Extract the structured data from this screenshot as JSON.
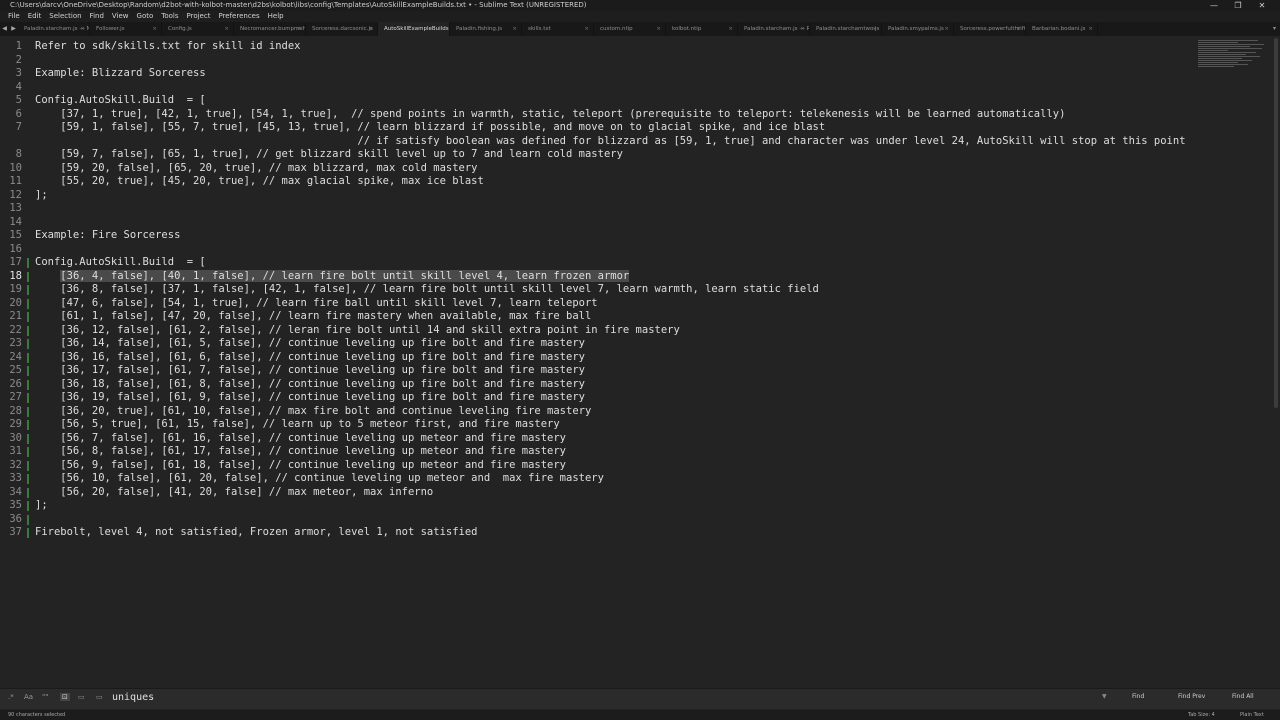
{
  "window": {
    "title": "C:\\Users\\darcv\\OneDrive\\Desktop\\Random\\d2bot-with-kolbot-master\\d2bs\\kolbot\\libs\\config\\Templates\\AutoSkillExampleBuilds.txt • - Sublime Text (UNREGISTERED)",
    "controls": [
      "—",
      "❐",
      "✕"
    ]
  },
  "menu": [
    "File",
    "Edit",
    "Selection",
    "Find",
    "View",
    "Goto",
    "Tools",
    "Project",
    "Preferences",
    "Help"
  ],
  "tabs": [
    "Paladin.starcham.js — New Kolbot\\...\\config",
    "Follower.js",
    "Config.js",
    "Necromancer.bumpmehard.js",
    "Sorceress.darcsonic.js",
    "AutoSkillExampleBuilds.txt",
    "Paladin.fishing.js",
    "skills.txt",
    "custom.ntip",
    "kolbot.ntip",
    "Paladin.starcham.js — Random\\...\\config",
    "Paladin.starchamtwo.js",
    "Paladin.smypalms.js",
    "Sorceress.powerfulthrift.js",
    "Barbarian.bodani.js"
  ],
  "active_tab": 5,
  "editor": {
    "selected_line": 18,
    "lines": [
      {
        "n": "1",
        "text": "Refer to sdk/skills.txt for skill id index"
      },
      {
        "n": "2",
        "text": ""
      },
      {
        "n": "3",
        "text": "Example: Blizzard Sorceress"
      },
      {
        "n": "4",
        "text": ""
      },
      {
        "n": "5",
        "text": "Config.AutoSkill.Build  = ["
      },
      {
        "n": "6",
        "text": "    [37, 1, true], [42, 1, true], [54, 1, true],  // spend points in warmth, static, teleport (prerequisite to teleport: telekenesis will be learned automatically)"
      },
      {
        "n": "7",
        "text": "    [59, 1, false], [55, 7, true], [45, 13, true], // learn blizzard if possible, and move on to glacial spike, and ice blast"
      },
      {
        "n": "",
        "text": "                                                   // if satisfy boolean was defined for blizzard as [59, 1, true] and character was under level 24, AutoSkill will stop at this point"
      },
      {
        "n": "8",
        "text": "    [59, 7, false], [65, 1, true], // get blizzard skill level up to 7 and learn cold mastery"
      },
      {
        "n": "10",
        "text": "    [59, 20, false], [65, 20, true], // max blizzard, max cold mastery"
      },
      {
        "n": "11",
        "text": "    [55, 20, true], [45, 20, true], // max glacial spike, max ice blast"
      },
      {
        "n": "12",
        "text": "];"
      },
      {
        "n": "13",
        "text": ""
      },
      {
        "n": "14",
        "text": ""
      },
      {
        "n": "15",
        "text": "Example: Fire Sorceress"
      },
      {
        "n": "16",
        "text": ""
      },
      {
        "n": "17",
        "text": "Config.AutoSkill.Build  = ["
      },
      {
        "n": "18",
        "text": "    [36, 4, false], [40, 1, false], // learn fire bolt until skill level 4, learn frozen armor"
      },
      {
        "n": "19",
        "text": "    [36, 8, false], [37, 1, false], [42, 1, false], // learn fire bolt until skill level 7, learn warmth, learn static field"
      },
      {
        "n": "20",
        "text": "    [47, 6, false], [54, 1, true], // learn fire ball until skill level 7, learn teleport"
      },
      {
        "n": "21",
        "text": "    [61, 1, false], [47, 20, false], // learn fire mastery when available, max fire ball"
      },
      {
        "n": "22",
        "text": "    [36, 12, false], [61, 2, false], // leran fire bolt until 14 and skill extra point in fire mastery"
      },
      {
        "n": "23",
        "text": "    [36, 14, false], [61, 5, false], // continue leveling up fire bolt and fire mastery"
      },
      {
        "n": "24",
        "text": "    [36, 16, false], [61, 6, false], // continue leveling up fire bolt and fire mastery"
      },
      {
        "n": "25",
        "text": "    [36, 17, false], [61, 7, false], // continue leveling up fire bolt and fire mastery"
      },
      {
        "n": "26",
        "text": "    [36, 18, false], [61, 8, false], // continue leveling up fire bolt and fire mastery"
      },
      {
        "n": "27",
        "text": "    [36, 19, false], [61, 9, false], // continue leveling up fire bolt and fire mastery"
      },
      {
        "n": "28",
        "text": "    [36, 20, true], [61, 10, false], // max fire bolt and continue leveling fire mastery"
      },
      {
        "n": "29",
        "text": "    [56, 5, true], [61, 15, false], // learn up to 5 meteor first, and fire mastery"
      },
      {
        "n": "30",
        "text": "    [56, 7, false], [61, 16, false], // continue leveling up meteor and fire mastery"
      },
      {
        "n": "31",
        "text": "    [56, 8, false], [61, 17, false], // continue leveling up meteor and fire mastery"
      },
      {
        "n": "32",
        "text": "    [56, 9, false], [61, 18, false], // continue leveling up meteor and fire mastery"
      },
      {
        "n": "33",
        "text": "    [56, 10, false], [61, 20, false], // continue leveling up meteor and  max fire mastery"
      },
      {
        "n": "34",
        "text": "    [56, 20, false], [41, 20, false] // max meteor, max inferno"
      },
      {
        "n": "35",
        "text": "];"
      },
      {
        "n": "36",
        "text": ""
      },
      {
        "n": "37",
        "text": "Firebolt, level 4, not satisfied, Frozen armor, level 1, not satisfied"
      }
    ]
  },
  "find_panel": {
    "query": "uniques",
    "options": [
      ".*",
      "Aa",
      "\"\"",
      "⊡",
      "▭"
    ],
    "buttons": [
      "Find",
      "Find Prev",
      "Find All"
    ]
  },
  "status": {
    "left": "90 characters selected",
    "tab_size": "Tab Size: 4",
    "syntax": "Plain Text"
  },
  "colors": {
    "background": "#232323",
    "selection": "#4a4a4a",
    "modified_marker": "#3b7a3b"
  }
}
